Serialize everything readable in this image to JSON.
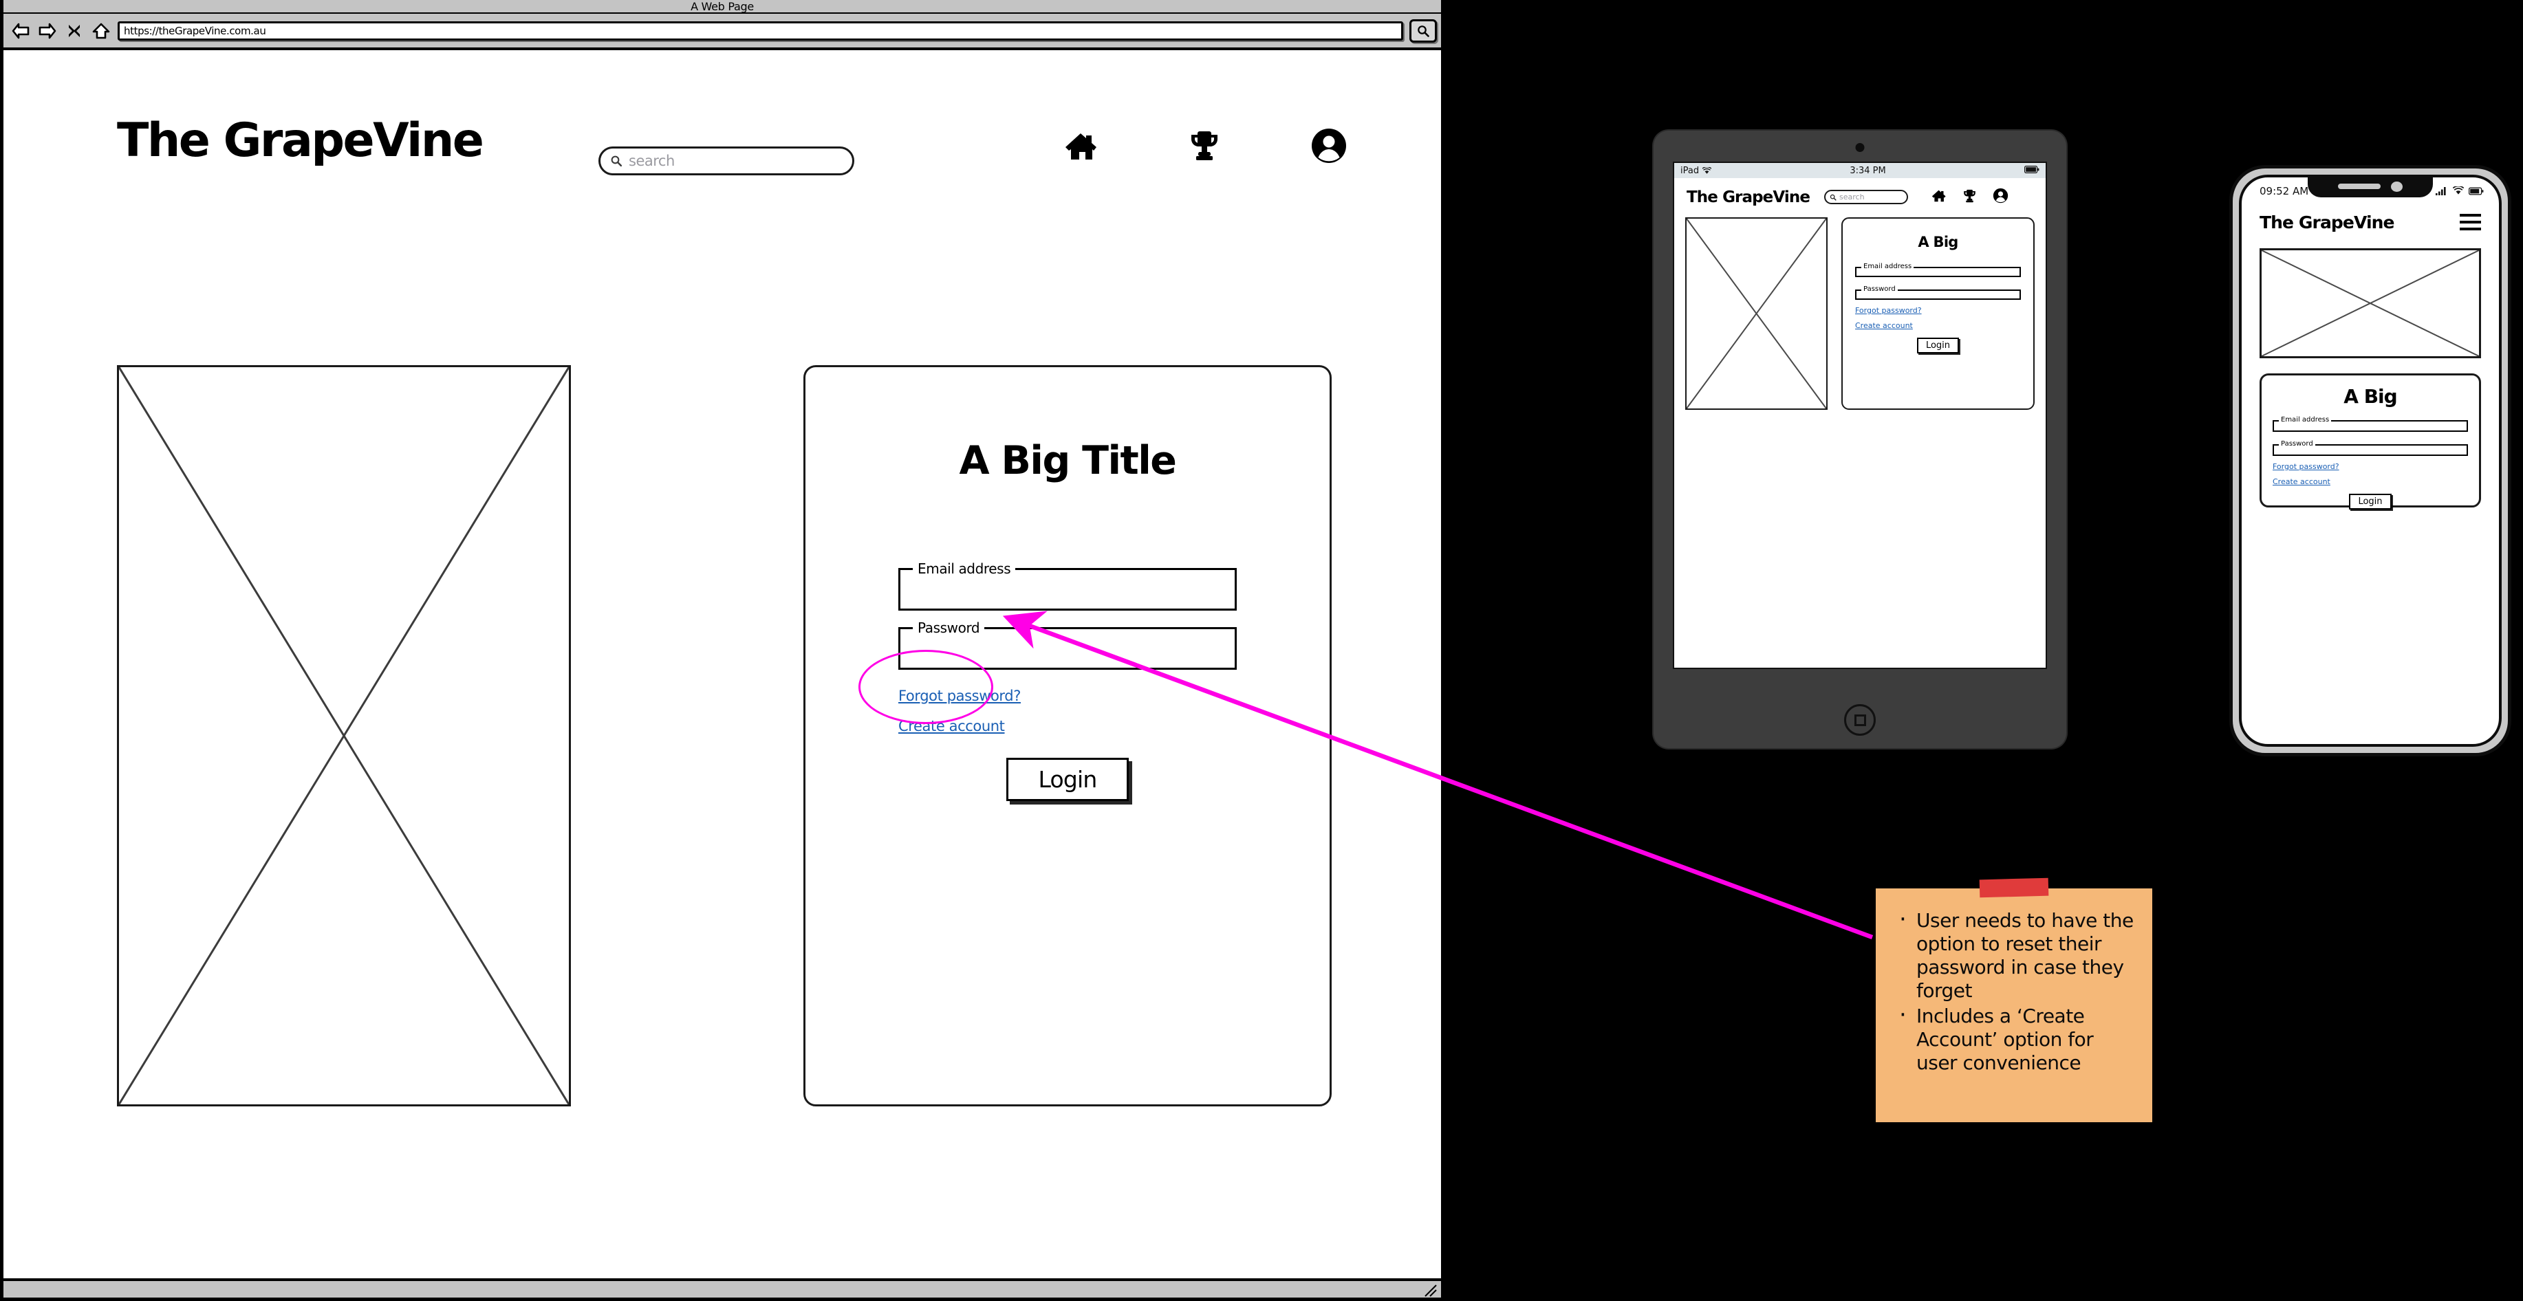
{
  "browser": {
    "window_title": "A Web Page",
    "url": "https://theGrapeVine.com.au",
    "nav": {
      "back": "back-arrow",
      "forward": "forward-arrow",
      "stop": "stop-x",
      "home": "home"
    },
    "toolbar_search_icon": "search-icon"
  },
  "site": {
    "brand": "The GrapeVine",
    "search_placeholder": "search",
    "nav_icons": [
      "home-icon",
      "trophy-icon",
      "account-icon"
    ]
  },
  "login": {
    "title": "A Big Title",
    "email_label": "Email address",
    "email_value": "",
    "password_label": "Password",
    "password_value": "",
    "forgot_link": "Forgot password?",
    "create_link": "Create account",
    "submit_label": "Login"
  },
  "tablet": {
    "device": "iPad",
    "time": "3:34 PM",
    "brand": "The GrapeVine",
    "search_placeholder": "search",
    "title": "A Big",
    "email_label": "Email address",
    "password_label": "Password",
    "forgot_link": "Forgot password?",
    "create_link": "Create account",
    "submit_label": "Login"
  },
  "phone": {
    "time": "09:52 AM",
    "brand": "The GrapeVine",
    "menu_icon": "hamburger-icon",
    "title": "A Big",
    "email_label": "Email address",
    "password_label": "Password",
    "forgot_link": "Forgot password?",
    "create_link": "Create account",
    "submit_label": "Login"
  },
  "annotation": {
    "notes": [
      "User needs to have the option to reset their password in case they forget",
      "Includes a ‘Create Account’ option for user convenience"
    ],
    "highlight_color": "#ff00e6",
    "note_color": "#f5b878",
    "tape_color": "#e03b3b"
  }
}
